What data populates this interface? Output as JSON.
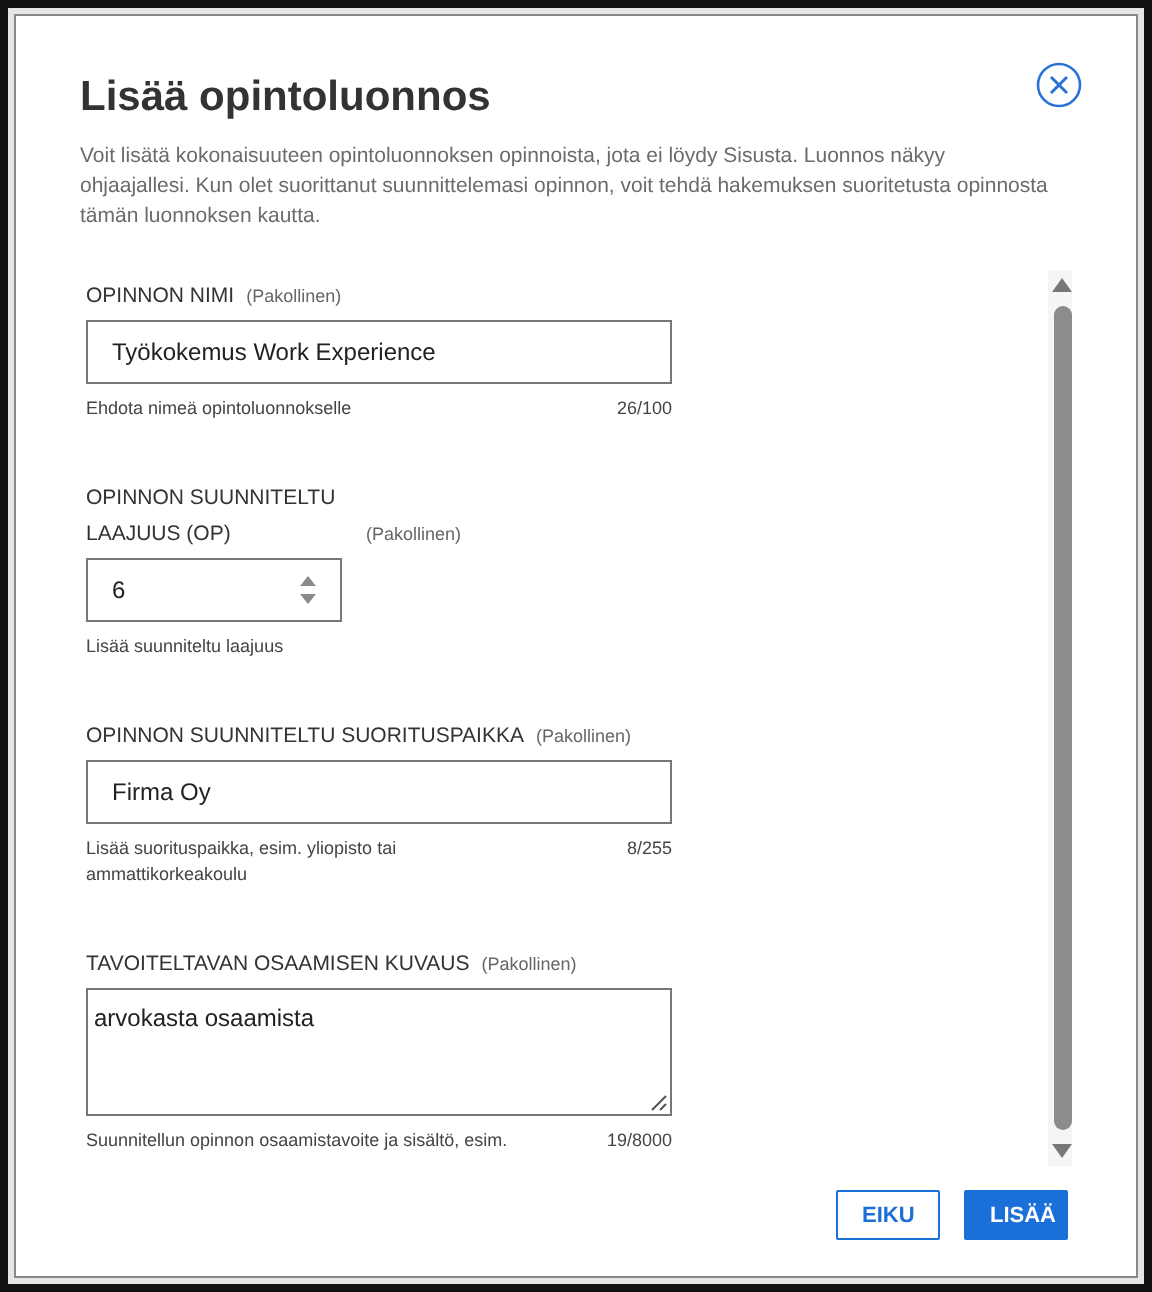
{
  "dialog": {
    "title": "Lisää opintoluonnos",
    "description": "Voit lisätä kokonaisuuteen opintoluonnoksen opinnoista, jota ei löydy Sisusta. Luonnos näkyy ohjaajallesi. Kun olet suorittanut suunnittelemasi opinnon, voit tehdä hakemuksen suoritetusta opinnosta tämän luonnoksen kautta."
  },
  "fields": [
    {
      "kind": "text",
      "label": "OPINNON NIMI",
      "required": "(Pakollinen)",
      "value": "Työkokemus Work Experience",
      "hint": "Ehdota nimeä opintoluonnokselle",
      "counter": "26/100"
    },
    {
      "kind": "number",
      "label": "OPINNON SUUNNITELTU LAAJUUS (OP)",
      "required": "(Pakollinen)",
      "value": "6",
      "hint": "Lisää suunniteltu laajuus"
    },
    {
      "kind": "text",
      "label": "OPINNON SUUNNITELTU SUORITUSPAIKKA",
      "required": "(Pakollinen)",
      "value": "Firma Oy",
      "hint": "Lisää suorituspaikka, esim. yliopisto tai ammattikorkeakoulu",
      "counter": "8/255"
    },
    {
      "kind": "textarea",
      "label": "TAVOITELTAVAN OSAAMISEN KUVAUS",
      "required": "(Pakollinen)",
      "value": "arvokasta osaamista",
      "hint": "Suunnitellun opinnon osaamistavoite ja sisältö, esim.",
      "counter": "19/8000"
    }
  ],
  "buttons": [
    {
      "kind": "secondary",
      "label": "EIKU"
    },
    {
      "kind": "primary",
      "label": "LISÄÄ"
    }
  ]
}
